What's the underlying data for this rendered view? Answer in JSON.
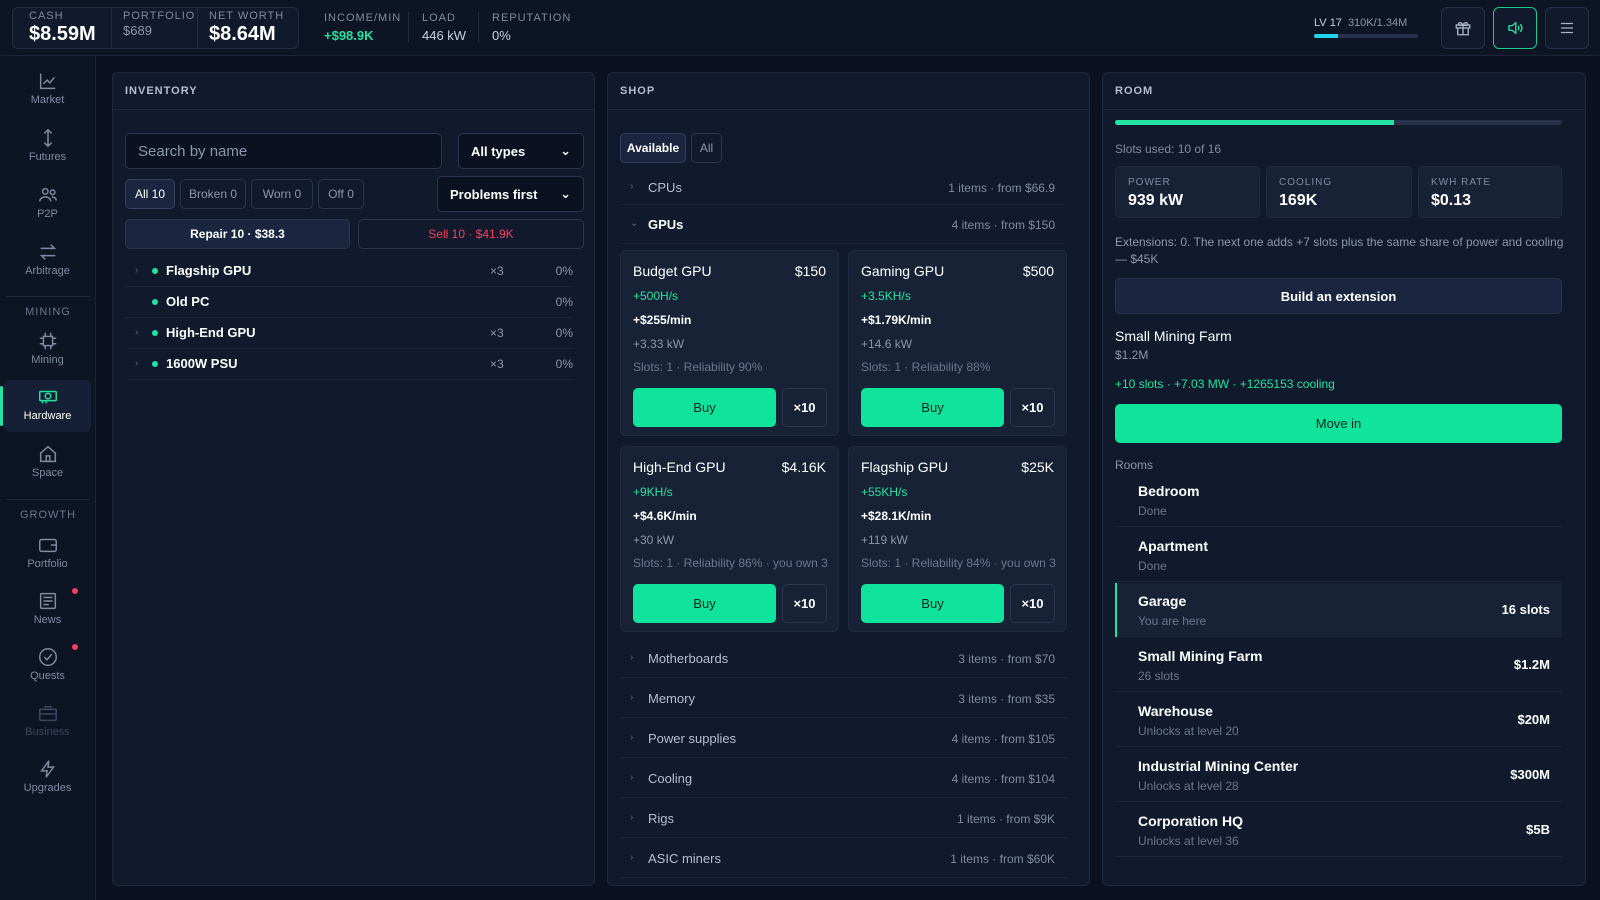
{
  "top": {
    "cash_label": "CASH",
    "cash_value": "$8.59M",
    "portfolio_label": "PORTFOLIO",
    "portfolio_value": "$689",
    "networth_label": "NET WORTH",
    "networth_value": "$8.64M",
    "income_label": "INCOME/MIN",
    "income_value": "+$98.9K",
    "load_label": "LOAD",
    "load_value": "446 kW",
    "reputation_label": "REPUTATION",
    "reputation_value": "0%",
    "level_label": "LV 17",
    "level_xp": "310K/1.34M",
    "level_progress": 0.23
  },
  "sidebar": {
    "items": [
      {
        "label": "Market"
      },
      {
        "label": "Futures"
      },
      {
        "label": "P2P"
      },
      {
        "label": "Arbitrage"
      },
      {
        "label": "Mining"
      },
      {
        "label": "Hardware"
      },
      {
        "label": "Space"
      },
      {
        "label": "Portfolio"
      },
      {
        "label": "News"
      },
      {
        "label": "Quests"
      },
      {
        "label": "Business"
      },
      {
        "label": "Upgrades"
      }
    ],
    "section_mining": "MINING",
    "section_growth": "GROWTH"
  },
  "inventory": {
    "title": "INVENTORY",
    "search_placeholder": "Search by name",
    "type_select": "All types",
    "sort_select": "Problems first",
    "filters": [
      "All 10",
      "Broken 0",
      "Worn 0",
      "Off 0"
    ],
    "repair_label": "Repair 10 · $38.3",
    "sell_label": "Sell 10 · $41.9K",
    "rows": [
      {
        "name": "Flagship GPU",
        "qty": "×3",
        "pct": "0%"
      },
      {
        "name": "Old PC",
        "qty": "",
        "pct": "0%"
      },
      {
        "name": "High-End GPU",
        "qty": "×3",
        "pct": "0%"
      },
      {
        "name": "1600W PSU",
        "qty": "×3",
        "pct": "0%"
      }
    ]
  },
  "shop": {
    "title": "SHOP",
    "tabs": [
      "Available",
      "All"
    ],
    "cpus": {
      "name": "CPUs",
      "info": "1 items · from $66.9"
    },
    "gpus": {
      "name": "GPUs",
      "info": "4 items · from $150"
    },
    "cards": [
      {
        "name": "Budget GPU",
        "price": "$150",
        "hash": "+500H/s",
        "income": "+$255/min",
        "power": "+3.33 kW",
        "meta": "Slots: 1 · Reliability 90%"
      },
      {
        "name": "Gaming GPU",
        "price": "$500",
        "hash": "+3.5KH/s",
        "income": "+$1.79K/min",
        "power": "+14.6 kW",
        "meta": "Slots: 1 · Reliability 88%"
      },
      {
        "name": "High-End GPU",
        "price": "$4.16K",
        "hash": "+9KH/s",
        "income": "+$4.6K/min",
        "power": "+30 kW",
        "meta": "Slots: 1 · Reliability 86% · you own 3"
      },
      {
        "name": "Flagship GPU",
        "price": "$25K",
        "hash": "+55KH/s",
        "income": "+$28.1K/min",
        "power": "+119 kW",
        "meta": "Slots: 1 · Reliability 84% · you own 3"
      }
    ],
    "buy_label": "Buy",
    "x10_label": "×10",
    "categories": [
      {
        "name": "Motherboards",
        "info": "3 items · from $70"
      },
      {
        "name": "Memory",
        "info": "3 items · from $35"
      },
      {
        "name": "Power supplies",
        "info": "4 items · from $105"
      },
      {
        "name": "Cooling",
        "info": "4 items · from $104"
      },
      {
        "name": "Rigs",
        "info": "1 items · from $9K"
      },
      {
        "name": "ASIC miners",
        "info": "1 items · from $60K"
      }
    ]
  },
  "room": {
    "title": "ROOM",
    "slots_fraction": 0.625,
    "slots_text": "Slots used: 10 of 16",
    "power_label": "POWER",
    "power_value": "939 kW",
    "cooling_label": "COOLING",
    "cooling_value": "169K",
    "kwh_label": "KWH RATE",
    "kwh_value": "$0.13",
    "extension_text": "Extensions: 0. The next one adds +7 slots plus the same share of power and cooling — $45K",
    "build_label": "Build an extension",
    "next_name": "Small Mining Farm",
    "next_price": "$1.2M",
    "next_stats": "+10 slots · +7.03 MW · +1265153 cooling",
    "move_label": "Move in",
    "rooms_label": "Rooms",
    "rooms": [
      {
        "name": "Bedroom",
        "sub": "Done",
        "val": ""
      },
      {
        "name": "Apartment",
        "sub": "Done",
        "val": ""
      },
      {
        "name": "Garage",
        "sub": "You are here",
        "val": "16 slots"
      },
      {
        "name": "Small Mining Farm",
        "sub": "26 slots",
        "val": "$1.2M"
      },
      {
        "name": "Warehouse",
        "sub": "Unlocks at level 20",
        "val": "$20M"
      },
      {
        "name": "Industrial Mining Center",
        "sub": "Unlocks at level 28",
        "val": "$300M"
      },
      {
        "name": "Corporation HQ",
        "sub": "Unlocks at level 36",
        "val": "$5B"
      }
    ]
  }
}
